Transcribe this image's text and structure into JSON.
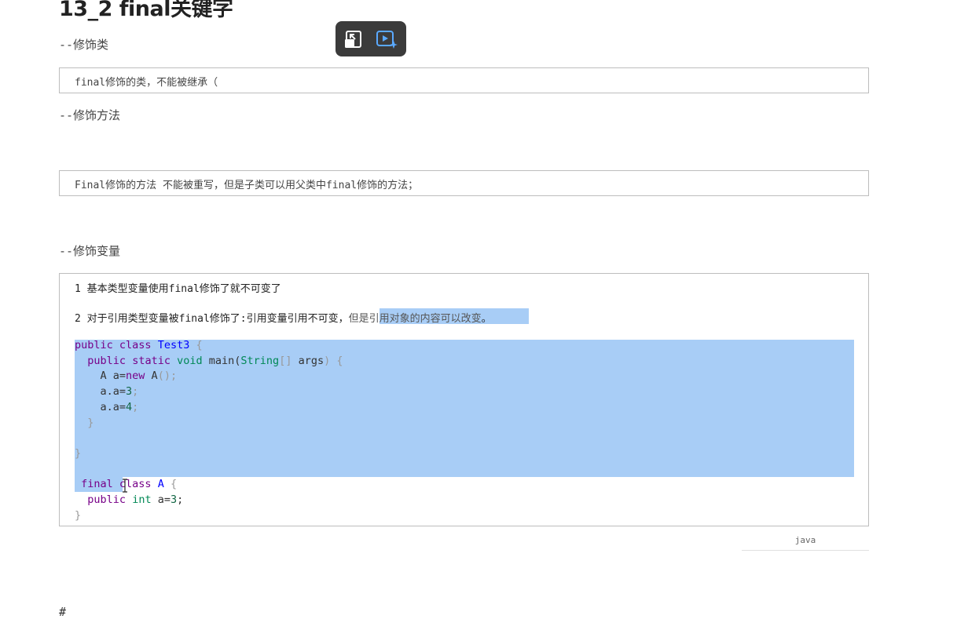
{
  "title": "13_2 final关键字",
  "sections": {
    "class_heading": "--修饰类",
    "class_note": "final修饰的类，不能被继承（",
    "method_heading": "--修饰方法",
    "method_note": "Final修饰的方法 不能被重写，但是子类可以用父类中final修饰的方法；",
    "variable_heading": "--修饰变量"
  },
  "code_block": {
    "line1": "1 基本类型变量使用final修饰了就不可变了",
    "line2_a": "2 对于引用类型变量被final修饰了:引用变量引用不可变，",
    "line2_b": "但是引用对象的内容可以改变",
    "line2_c": "。",
    "language": "java"
  },
  "footer": {
    "hash": "#"
  },
  "toolbar": {
    "icons": [
      "exit-pip-icon",
      "video-sparkle-icon"
    ]
  }
}
